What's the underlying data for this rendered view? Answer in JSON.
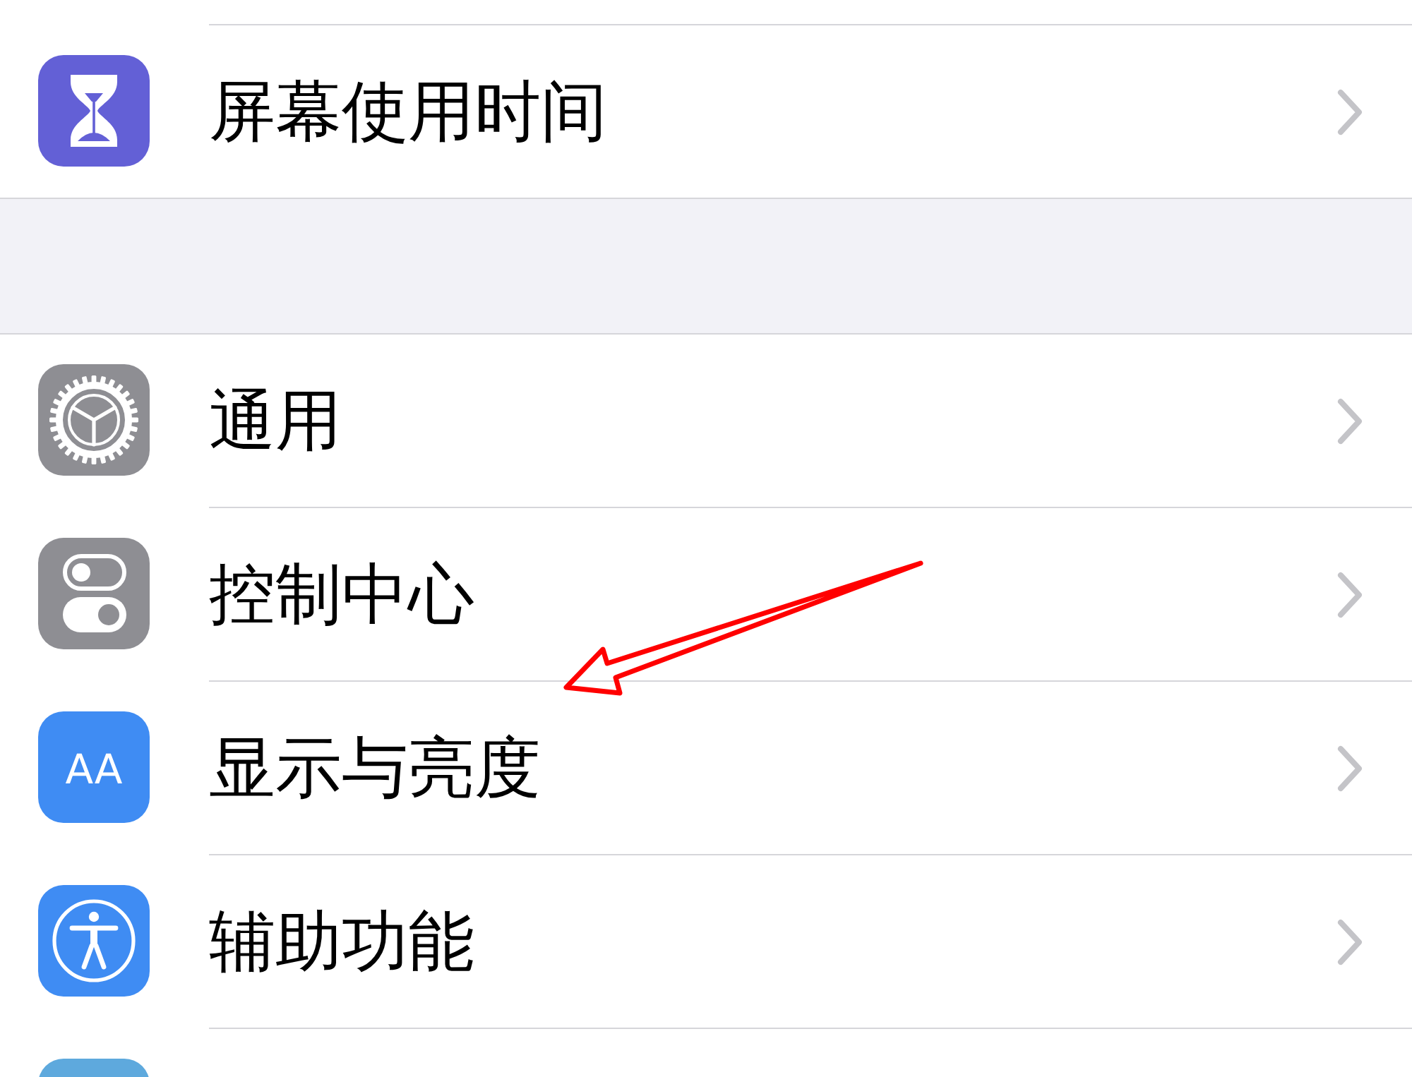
{
  "groups": [
    {
      "items": [
        {
          "label": "屏幕使用时间",
          "color": "#6360d6"
        }
      ]
    },
    {
      "items": [
        {
          "label": "通用",
          "color": "#8e8e93"
        },
        {
          "label": "控制中心",
          "color": "#8e8e93"
        },
        {
          "label": "显示与亮度",
          "color": "#3f8cf3",
          "glyph": "AA"
        },
        {
          "label": "辅助功能",
          "color": "#3f8cf3"
        },
        {
          "color": "#5ea9dd"
        }
      ]
    }
  ]
}
